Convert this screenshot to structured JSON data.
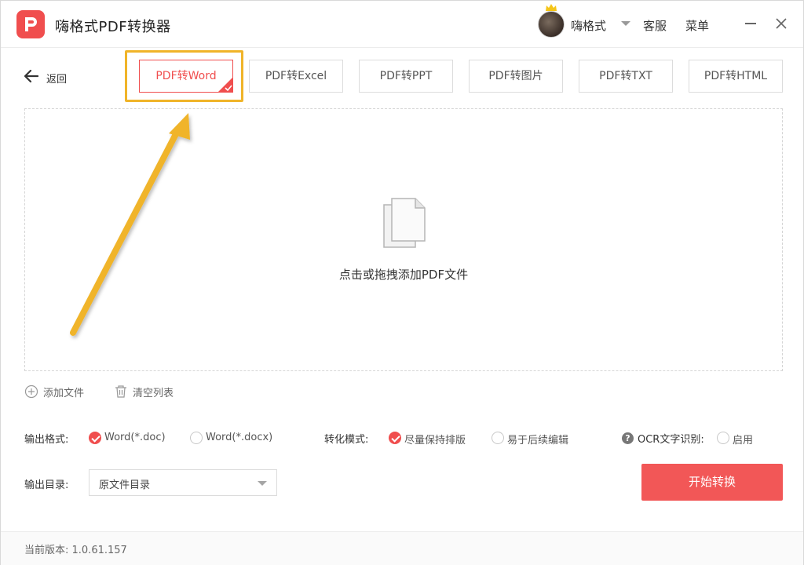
{
  "app": {
    "title": "嗨格式PDF转换器",
    "user": "嗨格式",
    "service": "客服",
    "menu": "菜单"
  },
  "nav": {
    "back_label": "返回"
  },
  "tabs": [
    {
      "label": "PDF转Word",
      "active": true
    },
    {
      "label": "PDF转Excel",
      "active": false
    },
    {
      "label": "PDF转PPT",
      "active": false
    },
    {
      "label": "PDF转图片",
      "active": false
    },
    {
      "label": "PDF转TXT",
      "active": false
    },
    {
      "label": "PDF转HTML",
      "active": false
    }
  ],
  "dropzone": {
    "text": "点击或拖拽添加PDF文件"
  },
  "actions": {
    "add_file": "添加文件",
    "clear_list": "清空列表"
  },
  "options": {
    "output_format_label": "输出格式:",
    "format_doc": "Word(*.doc)",
    "format_docx": "Word(*.docx)",
    "format_selected": "doc",
    "mode_label": "转化模式:",
    "mode_keep_layout": "尽量保持排版",
    "mode_easy_edit": "易于后续编辑",
    "mode_selected": "keep_layout",
    "ocr_label": "OCR文字识别:",
    "ocr_enable": "启用",
    "ocr_enabled": false,
    "output_dir_label": "输出目录:",
    "output_dir_value": "原文件目录"
  },
  "start_button": "开始转换",
  "footer": {
    "version": "当前版本: 1.0.61.157"
  },
  "colors": {
    "accent": "#f04e4e",
    "highlight": "#f0b429"
  }
}
